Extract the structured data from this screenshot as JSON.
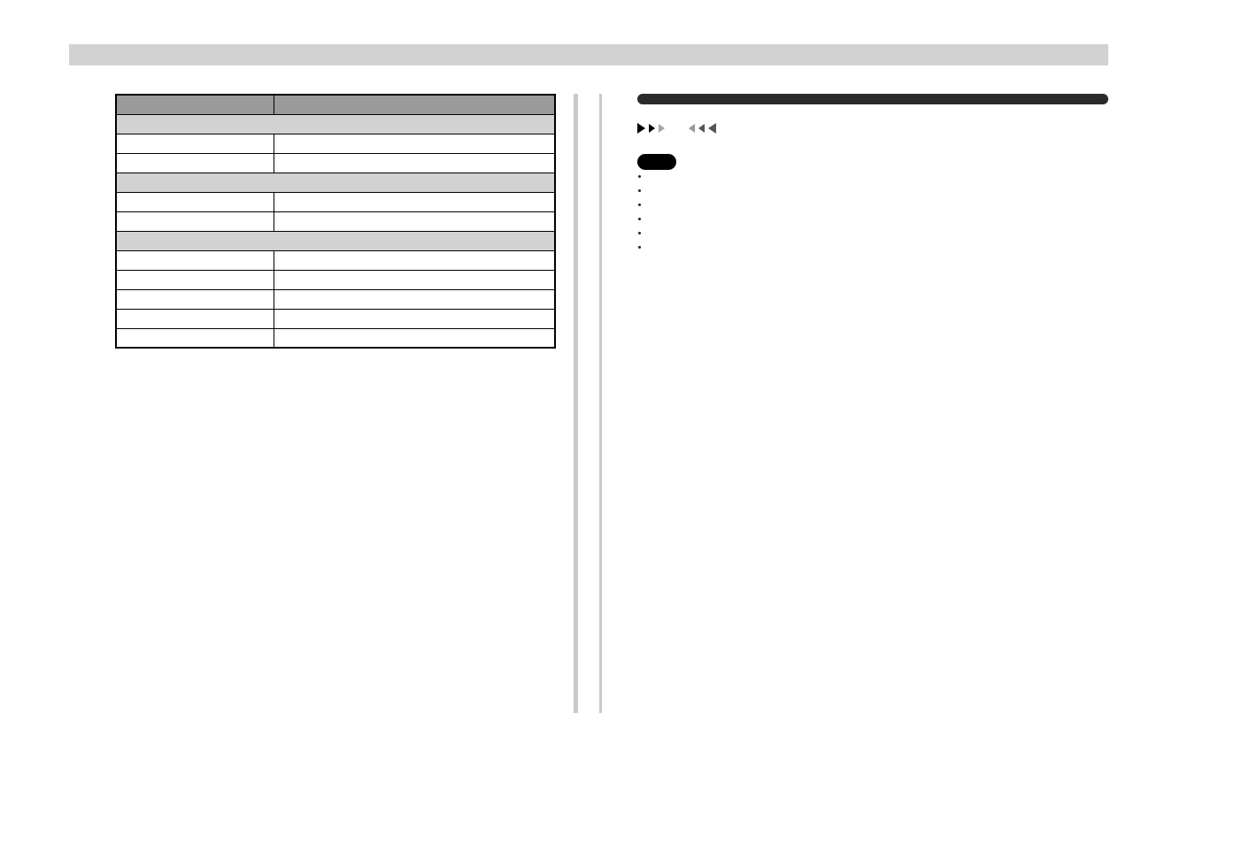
{
  "header": {
    "title": ""
  },
  "left": {
    "table": {
      "headers": [
        "",
        ""
      ],
      "groups": [
        {
          "label": "",
          "rows": [
            [
              "",
              ""
            ],
            [
              "",
              ""
            ]
          ]
        },
        {
          "label": "",
          "rows": [
            [
              "",
              ""
            ],
            [
              "",
              ""
            ]
          ]
        },
        {
          "label": "",
          "rows": [
            [
              "",
              ""
            ],
            [
              "",
              ""
            ],
            [
              "",
              ""
            ],
            [
              "",
              ""
            ],
            [
              "",
              ""
            ]
          ]
        }
      ]
    }
  },
  "right": {
    "section_title": "",
    "lead": "",
    "sub_h1": "",
    "icon_fwd_name": "fast-forward-icon",
    "icon_rev_name": "rewind-icon",
    "para1": "",
    "sub_h2": "",
    "para2": "",
    "note_title": "",
    "note_body_before": "",
    "badge": "",
    "note_body_after": "",
    "bullets": [
      "",
      "",
      "",
      "",
      "",
      ""
    ]
  }
}
